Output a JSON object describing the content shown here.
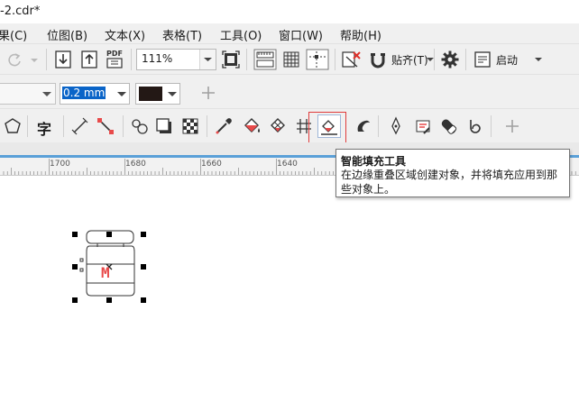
{
  "window": {
    "title": "-2.cdr*"
  },
  "menu": [
    {
      "label": "果(C)"
    },
    {
      "label": "位图(B)"
    },
    {
      "label": "文本(X)"
    },
    {
      "label": "表格(T)"
    },
    {
      "label": "工具(O)"
    },
    {
      "label": "窗口(W)"
    },
    {
      "label": "帮助(H)"
    }
  ],
  "toolbar": {
    "zoom_value": "111%",
    "pdf_label": "PDF",
    "snap_label": "贴齐(T)",
    "launch_label": "启动"
  },
  "property_bar": {
    "outline_width": "0.2 mm",
    "fill_color": "#231815"
  },
  "toolbox": {
    "text_tool_glyph": "字",
    "active_tool": "smart-fill-tool"
  },
  "ruler": {
    "labels": [
      "1700",
      "1680",
      "1660",
      "1640"
    ]
  },
  "tooltip": {
    "title": "智能填充工具",
    "description": "在边缘重叠区域创建对象，并将填充应用到那些对象上。"
  },
  "canvas": {
    "object_letter": "M",
    "accent_color": "#e84a4a"
  }
}
